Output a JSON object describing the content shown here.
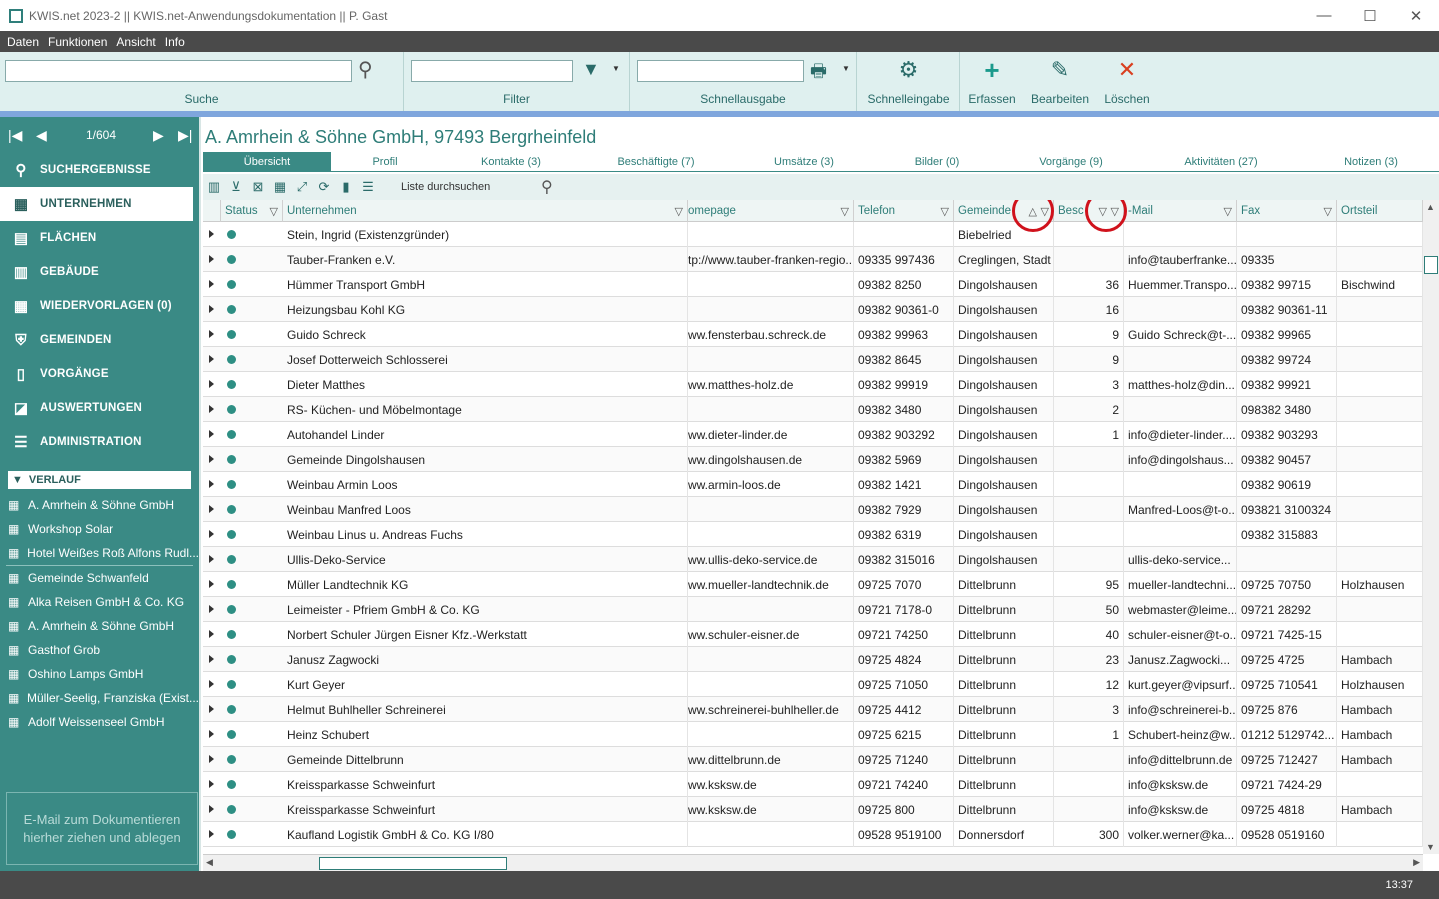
{
  "window": {
    "title": "KWIS.net 2023-2 || KWIS.net-Anwendungsdokumentation || P. Gast"
  },
  "menu": [
    "Daten",
    "Funktionen",
    "Ansicht",
    "Info"
  ],
  "ribbon": {
    "search_label": "Suche",
    "filter_label": "Filter",
    "schnellausgabe_label": "Schnellausgabe",
    "schnelleingabe_label": "Schnelleingabe",
    "erfassen_label": "Erfassen",
    "bearbeiten_label": "Bearbeiten",
    "loeschen_label": "Löschen"
  },
  "nav": {
    "position": "1/604"
  },
  "sidebar": {
    "items": [
      {
        "label": "SUCHERGEBNISSE",
        "icon": "search-icon"
      },
      {
        "label": "UNTERNEHMEN",
        "icon": "building-icon"
      },
      {
        "label": "FLÄCHEN",
        "icon": "area-icon"
      },
      {
        "label": "GEBÄUDE",
        "icon": "building-icon"
      },
      {
        "label": "WIEDERVORLAGEN (0)",
        "icon": "calendar-icon"
      },
      {
        "label": "GEMEINDEN",
        "icon": "shield-icon"
      },
      {
        "label": "VORGÄNGE",
        "icon": "door-icon"
      },
      {
        "label": "AUSWERTUNGEN",
        "icon": "chart-icon"
      },
      {
        "label": "ADMINISTRATION",
        "icon": "list-icon"
      }
    ],
    "verlauf_title": "VERLAUF",
    "verlauf": [
      "A. Amrhein & Söhne GmbH",
      "Workshop Solar",
      "Hotel Weißes Roß Alfons Rudl...",
      "Gemeinde Schwanfeld",
      "Alka Reisen GmbH & Co. KG",
      "A. Amrhein & Söhne GmbH",
      "Gasthof Grob",
      "Oshino Lamps GmbH",
      "Müller-Seelig, Franziska (Exist...",
      "Adolf Weissenseel GmbH"
    ],
    "dropzone": "E-Mail  zum Dokumentieren hierher ziehen und ablegen"
  },
  "main": {
    "company_title": "A. Amrhein & Söhne GmbH, 97493 Bergrheinfeld",
    "tabs": [
      "Übersicht",
      "Profil",
      "Kontakte (3)",
      "Beschäftigte (7)",
      "Umsätze (3)",
      "Bilder (0)",
      "Vorgänge (9)",
      "Aktivitäten (27)",
      "Notizen (3)"
    ],
    "list_search_placeholder": "Liste durchsuchen"
  },
  "table": {
    "columns": [
      "Status",
      "Unternehmen",
      "omepage",
      "Telefon",
      "Gemeinde",
      "Besc",
      "-Mail",
      "Fax",
      "Ortsteil"
    ],
    "rows": [
      [
        "Stein, Ingrid (Existenzgründer)",
        "",
        "",
        "Biebelried",
        "",
        "",
        "",
        ""
      ],
      [
        "Tauber-Franken e.V.",
        "tp://www.tauber-franken-regio...",
        "09335 997436",
        "Creglingen, Stadt",
        "",
        "info@tauberfranke...",
        "09335",
        ""
      ],
      [
        "Hümmer Transport GmbH",
        "",
        "09382 8250",
        "Dingolshausen",
        "36",
        "Huemmer.Transpo...",
        "09382 99715",
        "Bischwind"
      ],
      [
        "Heizungsbau Kohl KG",
        "",
        "09382 90361-0",
        "Dingolshausen",
        "16",
        "",
        "09382 90361-11",
        ""
      ],
      [
        "Guido Schreck",
        "ww.fensterbau.schreck.de",
        "09382 99963",
        "Dingolshausen",
        "9",
        "Guido Schreck@t-...",
        "09382 99965",
        ""
      ],
      [
        "Josef Dotterweich Schlosserei",
        "",
        "09382 8645",
        "Dingolshausen",
        "9",
        "",
        "09382 99724",
        ""
      ],
      [
        "Dieter Matthes",
        "ww.matthes-holz.de",
        "09382 99919",
        "Dingolshausen",
        "3",
        "matthes-holz@din...",
        "09382 99921",
        ""
      ],
      [
        "RS- Küchen- und Möbelmontage",
        "",
        "09382 3480",
        "Dingolshausen",
        "2",
        "",
        "098382 3480",
        ""
      ],
      [
        "Autohandel Linder",
        "ww.dieter-linder.de",
        "09382 903292",
        "Dingolshausen",
        "1",
        "info@dieter-linder....",
        "09382 903293",
        ""
      ],
      [
        "Gemeinde Dingolshausen",
        "ww.dingolshausen.de",
        "09382 5969",
        "Dingolshausen",
        "",
        "info@dingolshaus...",
        "09382 90457",
        ""
      ],
      [
        "Weinbau Armin Loos",
        "ww.armin-loos.de",
        "09382 1421",
        "Dingolshausen",
        "",
        "",
        "09382 90619",
        ""
      ],
      [
        "Weinbau Manfred Loos",
        "",
        "09382 7929",
        "Dingolshausen",
        "",
        "Manfred-Loos@t-o...",
        "093821 3100324",
        ""
      ],
      [
        "Weinbau Linus u. Andreas Fuchs",
        "",
        "09382 6319",
        "Dingolshausen",
        "",
        "",
        "09382 315883",
        ""
      ],
      [
        "Ullis-Deko-Service",
        "ww.ullis-deko-service.de",
        "09382 315016",
        "Dingolshausen",
        "",
        "ullis-deko-service...",
        "",
        ""
      ],
      [
        "Müller Landtechnik KG",
        "ww.mueller-landtechnik.de",
        "09725 7070",
        "Dittelbrunn",
        "95",
        "mueller-landtechni...",
        "09725 70750",
        "Holzhausen"
      ],
      [
        "Leimeister - Pfriem GmbH & Co. KG",
        "",
        "09721 7178-0",
        "Dittelbrunn",
        "50",
        "webmaster@leime...",
        "09721 28292",
        ""
      ],
      [
        "Norbert Schuler Jürgen Eisner Kfz.-Werkstatt",
        "ww.schuler-eisner.de",
        "09721 74250",
        "Dittelbrunn",
        "40",
        "schuler-eisner@t-o...",
        "09721 7425-15",
        ""
      ],
      [
        "Janusz Zagwocki",
        "",
        "09725 4824",
        "Dittelbrunn",
        "23",
        "Janusz.Zagwocki...",
        "09725 4725",
        "Hambach"
      ],
      [
        "Kurt Geyer",
        "",
        "09725 71050",
        "Dittelbrunn",
        "12",
        "kurt.geyer@vipsurf...",
        "09725 710541",
        "Holzhausen"
      ],
      [
        "Helmut Buhlheller Schreinerei",
        "ww.schreinerei-buhlheller.de",
        "09725 4412",
        "Dittelbrunn",
        "3",
        "info@schreinerei-b...",
        "09725 876",
        "Hambach"
      ],
      [
        "Heinz Schubert",
        "",
        "09725 6215",
        "Dittelbrunn",
        "1",
        "Schubert-heinz@w...",
        "01212 5129742...",
        "Hambach"
      ],
      [
        "Gemeinde Dittelbrunn",
        "ww.dittelbrunn.de",
        "09725 71240",
        "Dittelbrunn",
        "",
        "info@dittelbrunn.de",
        "09725 712427",
        "Hambach"
      ],
      [
        "Kreissparkasse Schweinfurt",
        "ww.ksksw.de",
        "09721 74240",
        "Dittelbrunn",
        "",
        "info@ksksw.de",
        "09721 7424-29",
        ""
      ],
      [
        "Kreissparkasse Schweinfurt",
        "ww.ksksw.de",
        "09725 800",
        "Dittelbrunn",
        "",
        "info@ksksw.de",
        "09725 4818",
        "Hambach"
      ],
      [
        "Kaufland Logistik GmbH & Co. KG  I/80",
        "",
        "09528 9519100",
        "Donnersdorf",
        "300",
        "volker.werner@ka...",
        "09528 0519160",
        ""
      ]
    ]
  },
  "status": {
    "time": "13:37"
  }
}
